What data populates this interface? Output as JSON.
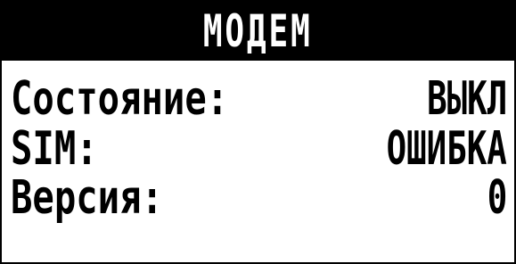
{
  "header": {
    "title": "МОДЕМ"
  },
  "rows": [
    {
      "label": "Состояние:",
      "value": "ВЫКЛ"
    },
    {
      "label": "SIM:",
      "value": "ОШИБКА"
    },
    {
      "label": "Версия:",
      "value": "0"
    }
  ],
  "colors": {
    "background": "#ffffff",
    "foreground": "#000000",
    "header_background": "#000000",
    "header_text": "#ffffff"
  }
}
